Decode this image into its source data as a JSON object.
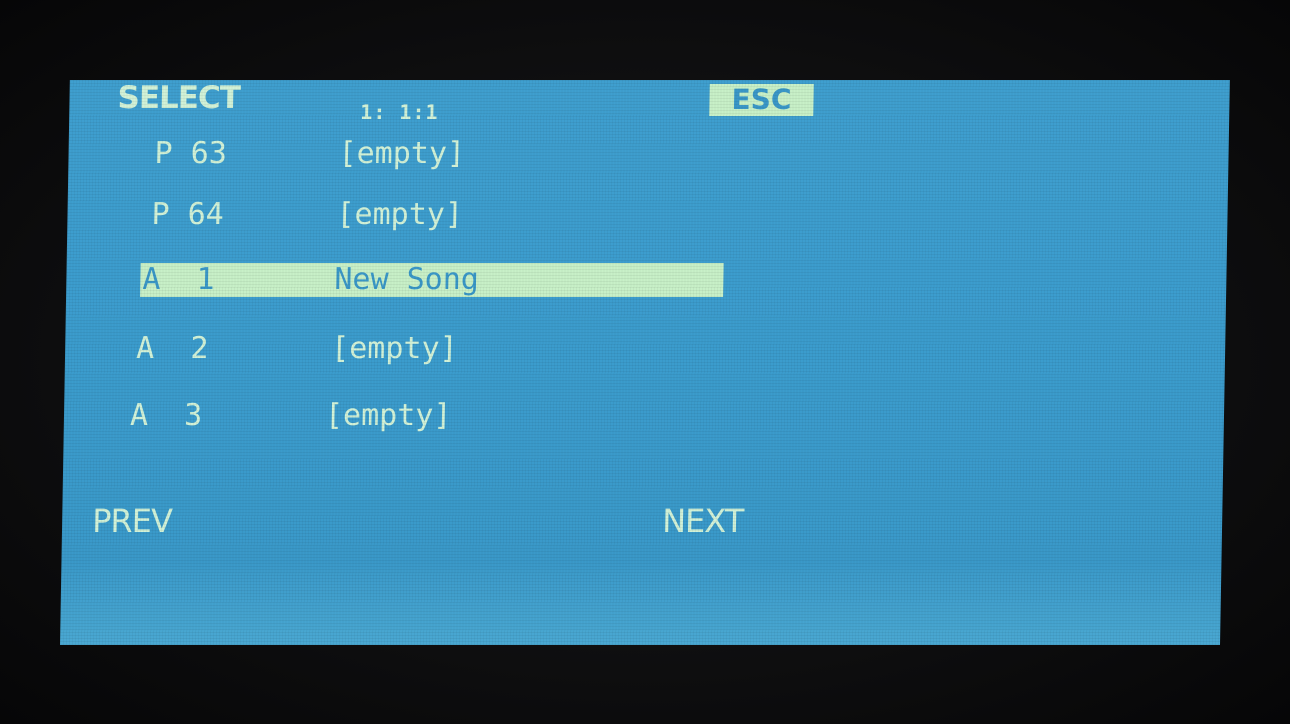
{
  "header": {
    "title": "SELECT",
    "position": "1: 1:1",
    "esc_label": "ESC"
  },
  "list": {
    "items": [
      {
        "slot": "P 63",
        "name": "[empty]",
        "selected": false
      },
      {
        "slot": "P 64",
        "name": "[empty]",
        "selected": false
      },
      {
        "slot": "A  1",
        "name": "New Song",
        "selected": true
      },
      {
        "slot": "A  2",
        "name": "[empty]",
        "selected": false
      },
      {
        "slot": "A  3",
        "name": "[empty]",
        "selected": false
      }
    ]
  },
  "softkeys": {
    "prev_label": "PREV",
    "next_label": "NEXT"
  },
  "colors": {
    "screen_background": "#3b9ccd",
    "text": "#d2f2d8",
    "highlight": "#c8f0c8"
  }
}
